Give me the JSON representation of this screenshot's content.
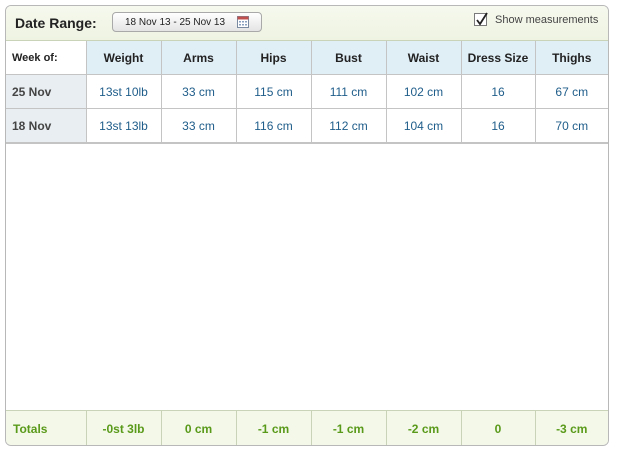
{
  "header": {
    "date_range_label": "Date Range:",
    "date_range_value": "18 Nov 13 - 25 Nov 13",
    "show_measurements_label": "Show measurements",
    "show_measurements_checked": true
  },
  "table": {
    "week_of_label": "Week of:",
    "columns": [
      "Weight",
      "Arms",
      "Hips",
      "Bust",
      "Waist",
      "Dress Size",
      "Thighs"
    ],
    "rows": [
      {
        "date": "25 Nov",
        "values": [
          "13st 10lb",
          "33 cm",
          "115 cm",
          "111 cm",
          "102 cm",
          "16",
          "67 cm"
        ]
      },
      {
        "date": "18 Nov",
        "values": [
          "13st 13lb",
          "33 cm",
          "116 cm",
          "112 cm",
          "104 cm",
          "16",
          "70 cm"
        ]
      }
    ]
  },
  "totals": {
    "label": "Totals",
    "values": [
      "-0st 3lb",
      "0 cm",
      "-1 cm",
      "-1 cm",
      "-2 cm",
      "0",
      "-3 cm"
    ]
  },
  "colors": {
    "header_bg": "#eef3e2",
    "column_header_bg": "#e0eef6",
    "value_text": "#1f5d8a",
    "totals_text": "#5a9a1a"
  }
}
